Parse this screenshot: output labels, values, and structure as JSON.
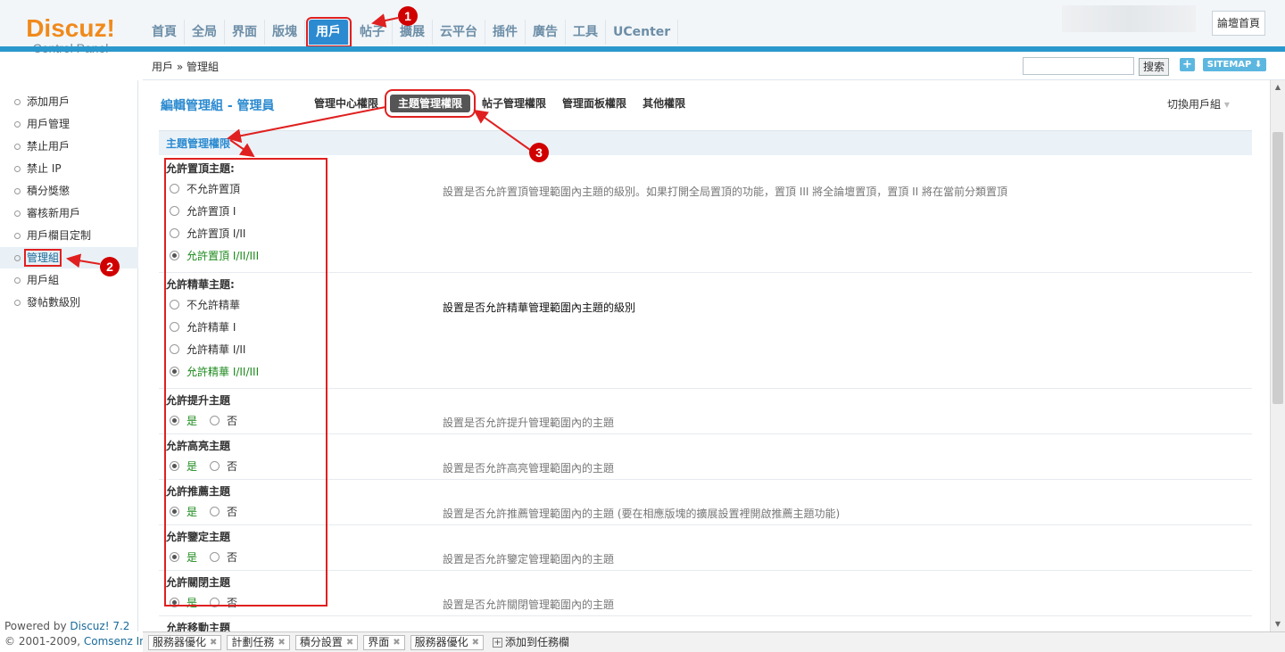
{
  "header": {
    "logo_main": "Discuz!",
    "logo_sub": "Control Panel",
    "nav": [
      "首頁",
      "全局",
      "界面",
      "版塊",
      "用戶",
      "帖子",
      "擴展",
      "云平台",
      "插件",
      "廣告",
      "工具",
      "UCenter"
    ],
    "active_nav": "用戶",
    "home_button": "論壇首頁"
  },
  "breadcrumb": "用戶 » 管理組",
  "search": {
    "value": "",
    "button": "搜索"
  },
  "sitemap_label": "SITEMAP",
  "plus_label": "+",
  "sidebar": {
    "items": [
      "添加用戶",
      "用戶管理",
      "禁止用戶",
      "禁止 IP",
      "積分獎懲",
      "審核新用戶",
      "用戶欄目定制",
      "管理組",
      "用戶組",
      "發帖數級別"
    ],
    "active": "管理組"
  },
  "footer": {
    "powered_prefix": "Powered by ",
    "powered_name": "Discuz! 7.2",
    "copyright_prefix": "© 2001-2009, ",
    "company": "Comsenz Inc."
  },
  "main": {
    "title": "編輯管理組 - 管理員",
    "tabs": [
      "管理中心權限",
      "主題管理權限",
      "帖子管理權限",
      "管理面板權限",
      "其他權限"
    ],
    "active_tab": "主題管理權限",
    "switch_group": "切換用戶組",
    "section_title": "主題管理權限",
    "settings": [
      {
        "title": "允許置頂主題:",
        "options": [
          "不允許置頂",
          "允許置頂 I",
          "允許置頂 I/II",
          "允許置頂 I/II/III"
        ],
        "selected": 3,
        "desc": "設置是否允許置頂管理範圍內主題的級別。如果打開全局置頂的功能，置頂 III 將全論壇置頂，置頂 II 將在當前分類置頂"
      },
      {
        "title": "允許精華主題:",
        "options": [
          "不允許精華",
          "允許精華 I",
          "允許精華 I/II",
          "允許精華 I/II/III"
        ],
        "selected": 3,
        "desc": "設置是否允許精華管理範圍內主題的級別"
      },
      {
        "title": "允許提升主題",
        "yes": "是",
        "no": "否",
        "selected": 0,
        "desc": "設置是否允許提升管理範圍內的主題"
      },
      {
        "title": "允許高亮主題",
        "yes": "是",
        "no": "否",
        "selected": 0,
        "desc": "設置是否允許高亮管理範圍內的主題"
      },
      {
        "title": "允許推薦主題",
        "yes": "是",
        "no": "否",
        "selected": 0,
        "desc": "設置是否允許推薦管理範圍內的主題 (要在相應版塊的擴展設置裡開啟推薦主題功能)"
      },
      {
        "title": "允許鑒定主題",
        "yes": "是",
        "no": "否",
        "selected": 0,
        "desc": "設置是否允許鑒定管理範圍內的主題"
      },
      {
        "title": "允許關閉主題",
        "yes": "是",
        "no": "否",
        "selected": 0,
        "desc": "設置是否允許關閉管理範圍內的主題"
      },
      {
        "title": "允許移動主題"
      }
    ]
  },
  "taskbar": {
    "items": [
      "服務器優化",
      "計劃任務",
      "積分設置",
      "界面",
      "服務器優化"
    ],
    "add_label": "添加到任務欄"
  },
  "annotations": [
    "1",
    "2",
    "3"
  ],
  "colors": {
    "accent": "#2b8ad0",
    "highlight": "#e02020",
    "logo": "#f08a1c",
    "selected_option": "#1d8a1d"
  }
}
